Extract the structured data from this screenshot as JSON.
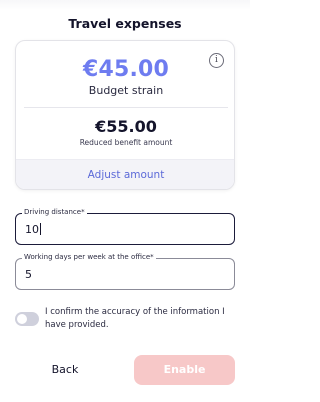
{
  "page": {
    "title": "Travel expenses"
  },
  "summary_card": {
    "budget_amount": "€45.00",
    "budget_label": "Budget strain",
    "reduced_amount": "€55.00",
    "reduced_label": "Reduced benefit amount",
    "info_icon": "i",
    "adjust_label": "Adjust amount",
    "accent_color": "#6e7cf0"
  },
  "form": {
    "driving_distance": {
      "label": "Driving distance*",
      "value": "10"
    },
    "working_days": {
      "label": "Working days per week at the office*",
      "value": "5"
    },
    "confirm": {
      "text": "I confirm the accuracy of the information I have provided.",
      "checked": false
    }
  },
  "actions": {
    "back_label": "Back",
    "enable_label": "Enable",
    "enable_color": "#f7c8c8"
  }
}
